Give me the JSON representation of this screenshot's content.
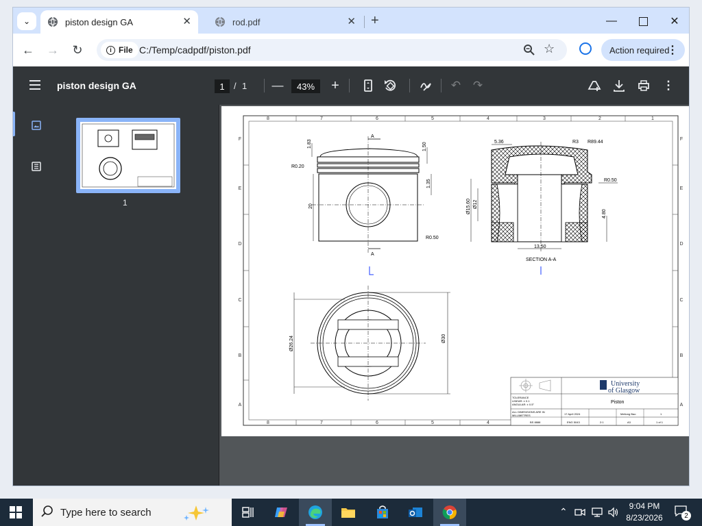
{
  "browser": {
    "tabs": [
      {
        "label": "piston design GA",
        "active": true
      },
      {
        "label": "rod.pdf",
        "active": false
      }
    ],
    "address": {
      "chip_label": "File",
      "url": "C:/Temp/cadpdf/piston.pdf"
    },
    "action_required_label": "Action required"
  },
  "pdf": {
    "title": "piston design GA",
    "page_current": "1",
    "page_sep": "/",
    "page_total": "1",
    "zoom": "43%",
    "thumbnail_label": "1"
  },
  "drawing": {
    "col_labels": [
      "8",
      "7",
      "6",
      "5",
      "4",
      "3",
      "2",
      "1"
    ],
    "row_labels": [
      "F",
      "E",
      "D",
      "C",
      "B",
      "A"
    ],
    "dims_front": {
      "d1": "1.83",
      "d2": "1.50",
      "d3": "R0.20",
      "d4": "1.35",
      "d5": "20",
      "d6": "R0.50",
      "sec_a_top": "A",
      "sec_a_bot": "A"
    },
    "dims_section": {
      "d1": "5.36",
      "d2": "R3",
      "d3": "R89.44",
      "d4": "R0.50",
      "d5": "Ø15.60",
      "d6": "Ø12",
      "d7": "4.80",
      "d8": "13.50",
      "label": "SECTION A-A"
    },
    "dims_top": {
      "d1": "Ø26.24",
      "d2": "Ø30"
    },
    "title_block": {
      "university_line1": "University",
      "university_line2": "of Glasgow",
      "part_name": "Piston",
      "tolerance_title": "TOLERANCE",
      "tol_linear": "LINEAR: ± 0.1",
      "tol_angular": "ANGULAR: ± 0.5°",
      "dims_note_1": "ALL DIMENSIONS ARE IN",
      "dims_note_2": "MILLIMETRES",
      "date": "17 April 2024",
      "drawn_by": "Meitong Bao",
      "sheet_no": "1",
      "course": "ENG 5043",
      "scale": "2:1",
      "size": "A3",
      "sheet": "1 of 1",
      "drafting_std": "BS 8888"
    }
  },
  "taskbar": {
    "search_placeholder": "Type here to search",
    "time": "9:04 PM",
    "date": "8/23/2026",
    "notifications": "2"
  }
}
